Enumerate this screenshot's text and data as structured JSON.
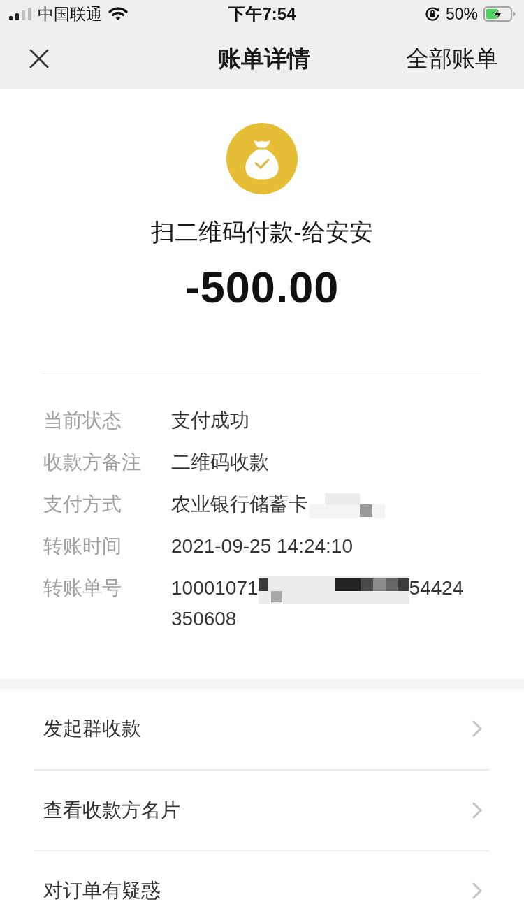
{
  "status_bar": {
    "carrier": "中国联通",
    "time": "下午7:54",
    "battery_percent": "50%"
  },
  "nav_bar": {
    "title": "账单详情",
    "action": "全部账单"
  },
  "summary": {
    "title": "扫二维码付款-给安安",
    "amount": "-500.00"
  },
  "details": [
    {
      "label": "当前状态",
      "value": "支付成功",
      "redacted": false
    },
    {
      "label": "收款方备注",
      "value": "二维码收款",
      "redacted": false
    },
    {
      "label": "支付方式",
      "value": "农业银行储蓄卡",
      "redacted": true
    },
    {
      "label": "转账时间",
      "value": "2021-09-25 14:24:10",
      "redacted": false
    },
    {
      "label": "转账单号",
      "value": "10001071",
      "redacted": true,
      "value_end": "54424350608"
    }
  ],
  "actions": [
    {
      "label": "发起群收款"
    },
    {
      "label": "查看收款方名片"
    },
    {
      "label": "对订单有疑惑"
    }
  ]
}
